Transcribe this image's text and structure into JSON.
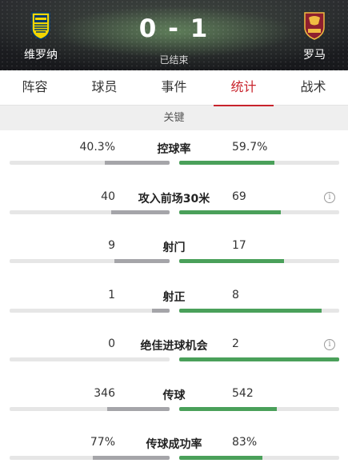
{
  "header": {
    "home_team": "维罗纳",
    "away_team": "罗马",
    "score": "0 - 1",
    "status": "已结束",
    "home_colors": {
      "primary": "#f2d600",
      "secondary": "#003a70"
    },
    "away_colors": {
      "primary": "#8e1f2f",
      "secondary": "#f0bc42"
    }
  },
  "tabs": [
    {
      "label": "阵容",
      "active": false
    },
    {
      "label": "球员",
      "active": false
    },
    {
      "label": "事件",
      "active": false
    },
    {
      "label": "统计",
      "active": true
    },
    {
      "label": "战术",
      "active": false
    }
  ],
  "section": {
    "title": "关键"
  },
  "stats": [
    {
      "label": "控球率",
      "home": "40.3%",
      "away": "59.7%",
      "home_share": 0.403,
      "away_share": 0.597,
      "info": false
    },
    {
      "label": "攻入前场30米",
      "home": "40",
      "away": "69",
      "home_share": 0.367,
      "away_share": 0.633,
      "info": true
    },
    {
      "label": "射门",
      "home": "9",
      "away": "17",
      "home_share": 0.346,
      "away_share": 0.654,
      "info": false
    },
    {
      "label": "射正",
      "home": "1",
      "away": "8",
      "home_share": 0.111,
      "away_share": 0.889,
      "info": false
    },
    {
      "label": "绝佳进球机会",
      "home": "0",
      "away": "2",
      "home_share": 0.0,
      "away_share": 1.0,
      "info": true
    },
    {
      "label": "传球",
      "home": "346",
      "away": "542",
      "home_share": 0.39,
      "away_share": 0.61,
      "info": false
    },
    {
      "label": "传球成功率",
      "home": "77%",
      "away": "83%",
      "home_share": 0.481,
      "away_share": 0.519,
      "info": false
    }
  ],
  "colors": {
    "accent": "#c8232c",
    "home_bar": "#a5a5a9",
    "away_bar": "#4aa05a",
    "track": "#e6e6e6"
  },
  "icons": {
    "info": "info-icon",
    "info_glyph": "i"
  }
}
